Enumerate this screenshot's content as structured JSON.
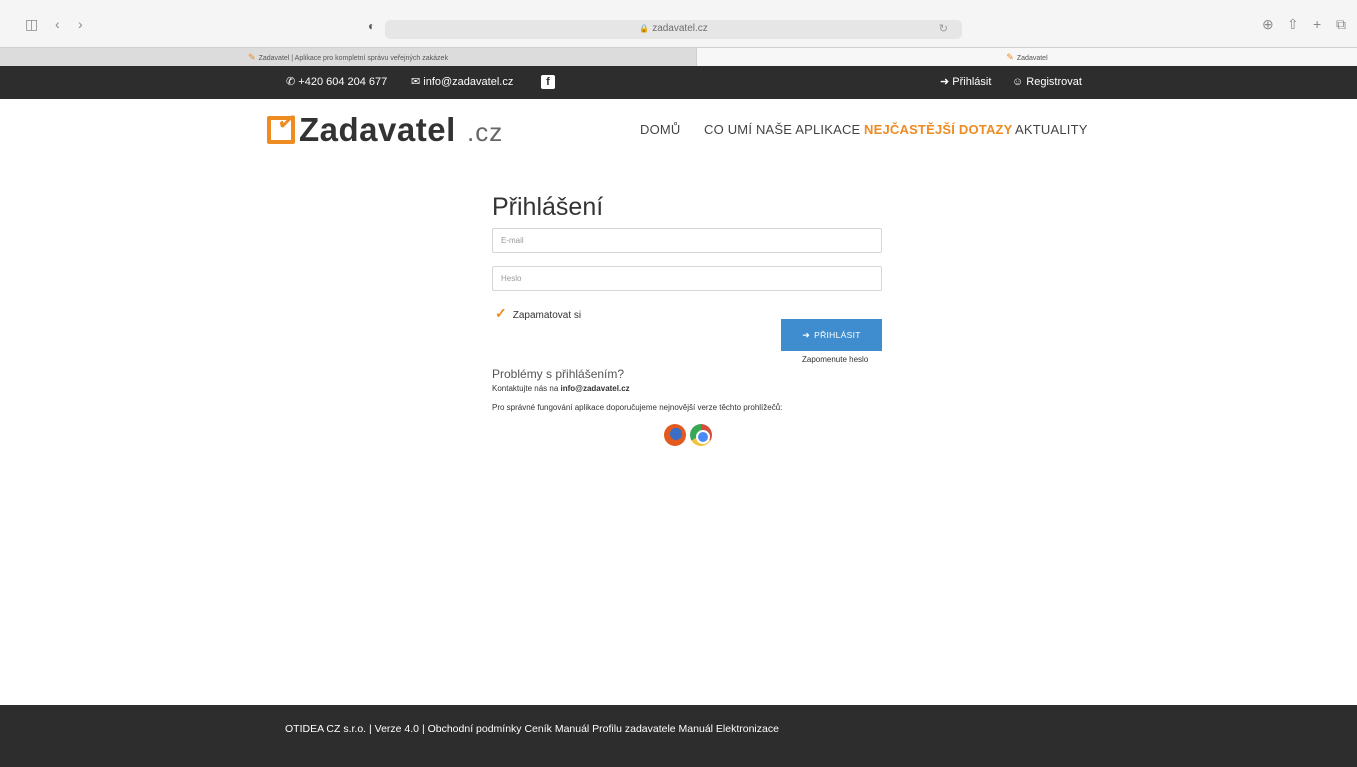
{
  "browser": {
    "url": "zadavatel.cz",
    "tabs": [
      {
        "label": "Zadavatel | Aplikace pro kompletní správu veřejných zakázek"
      },
      {
        "label": "Zadavatel"
      }
    ],
    "icons": [
      "sidebar-icon",
      "back-icon",
      "forward-icon",
      "shield-icon",
      "download-icon",
      "share-icon",
      "new-tab-icon",
      "tab-overview-icon"
    ]
  },
  "topbar": {
    "phone": "+420 604 204 677",
    "email": "info@zadavatel.cz",
    "login": "Přihlásit",
    "register": "Registrovat"
  },
  "header": {
    "logo_text": "Zadavatel",
    "logo_tld": ".cz",
    "nav": [
      {
        "label": "DOMŮ"
      },
      {
        "label": "CO UMÍ NAŠE APLIKACE"
      },
      {
        "label": "NEJČASTĚJŠÍ DOTAZY"
      },
      {
        "label": "AKTUALITY"
      }
    ],
    "accent_color": "#ee8b22"
  },
  "login": {
    "title": "Přihlášení",
    "email_placeholder": "E-mail",
    "password_placeholder": "Heslo",
    "remember_label": "Zapamatovat si",
    "submit_label": "PŘIHLÁSIT",
    "forgot_label": "Zapomenute heslo",
    "problems_title": "Problémy s přihlášením?",
    "contact_prefix": "Kontaktujte nás na ",
    "contact_email": "info@zadavatel.cz",
    "browsers_note": "Pro správné fungování aplikace doporučujeme nejnovější verze těchto prohlížečů:",
    "button_color": "#3f8dce"
  },
  "footer": {
    "text": "OTIDEA CZ s.r.o. | Verze 4.0 | Obchodní podmínky  Ceník  Manuál Profilu zadavatele  Manuál Elektronizace"
  }
}
